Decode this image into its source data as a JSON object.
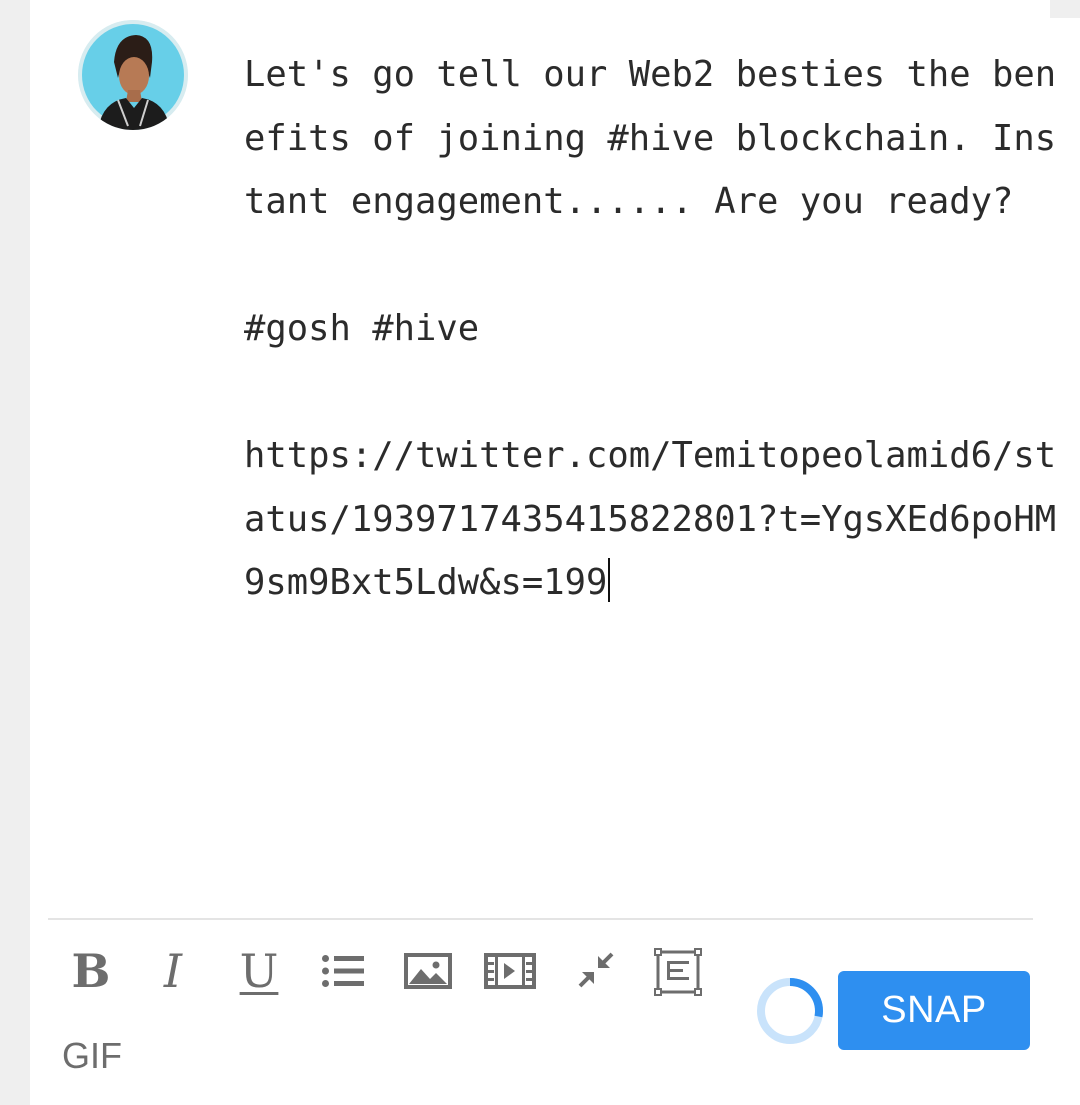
{
  "composer": {
    "avatar_label": "user avatar",
    "text": "Let's go tell our Web2 besties the benefits of joining #hive blockchain. Instant engagement...... Are you ready?\n\n#gosh #hive\n\nhttps://twitter.com/Temitopeolamid6/status/1939717435415822801?t=YgsXEd6poHM9sm9Bxt5Ldw&s=199"
  },
  "toolbar": {
    "bold_label": "B",
    "italic_label": "I",
    "underline_label": "U",
    "gif_label": "GIF",
    "icons": [
      "bullet-list-icon",
      "image-icon",
      "video-icon",
      "compress-icon",
      "fullscreen-icon"
    ]
  },
  "submit": {
    "label": "SNAP",
    "color": "#2e8ff0",
    "character_progress": 0.28
  }
}
